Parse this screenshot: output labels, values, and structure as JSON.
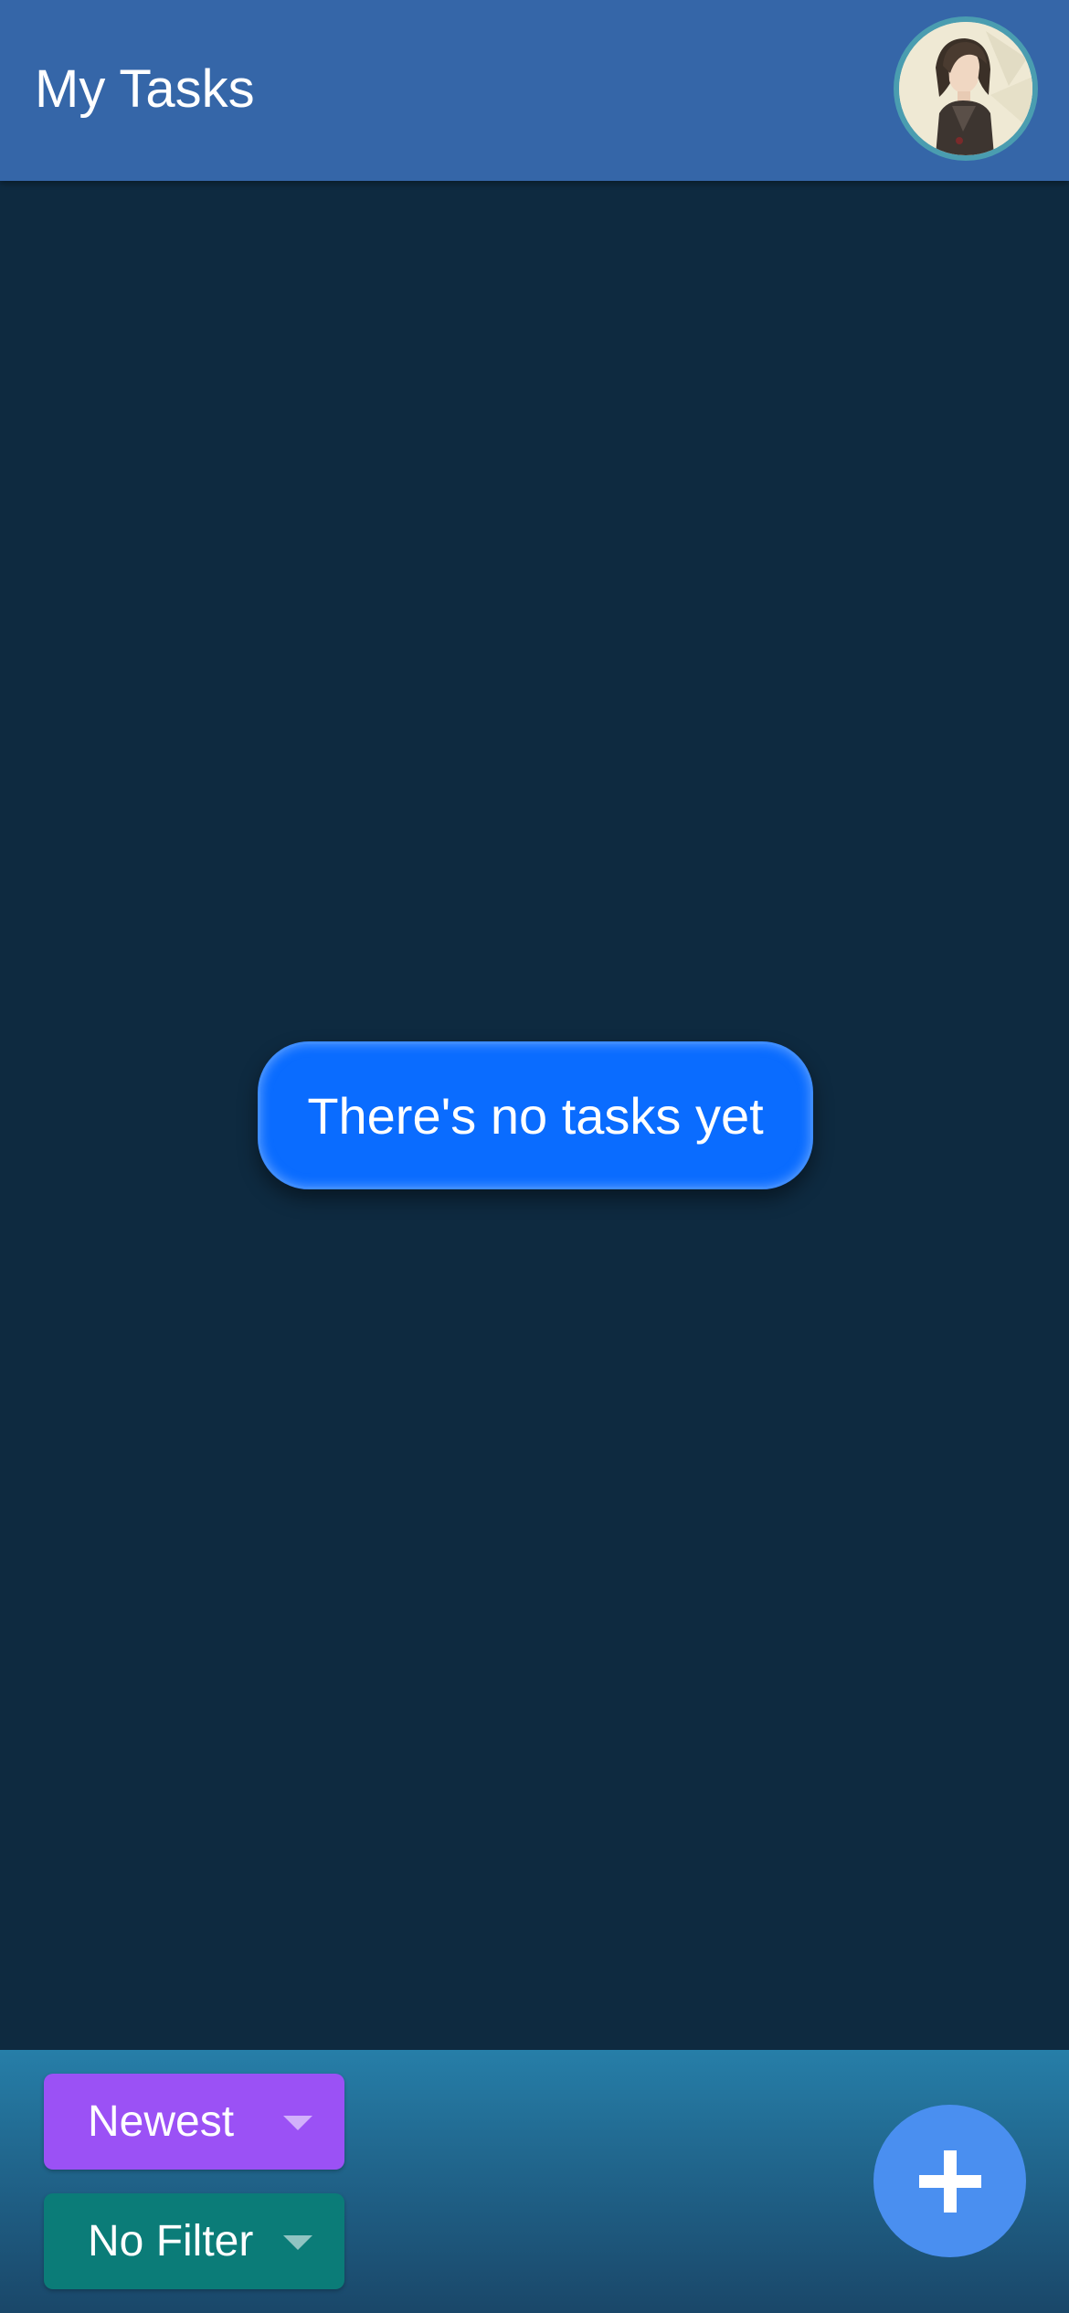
{
  "header": {
    "title": "My Tasks",
    "avatar_icon": "user-avatar"
  },
  "empty_state": {
    "message": "There's no tasks yet"
  },
  "footer": {
    "sort": {
      "selected": "Newest",
      "icon": "chevron-down-icon"
    },
    "filter": {
      "selected": "No Filter",
      "icon": "chevron-down-icon"
    },
    "add_button": {
      "icon": "plus-icon"
    }
  },
  "colors": {
    "header_bg": "#3566a8",
    "page_bg": "#0e2a40",
    "pill_bg": "#0a6cff",
    "sort_bg": "#9b51f5",
    "filter_bg": "#0b7c78",
    "fab_bg": "#4a8ff0"
  }
}
